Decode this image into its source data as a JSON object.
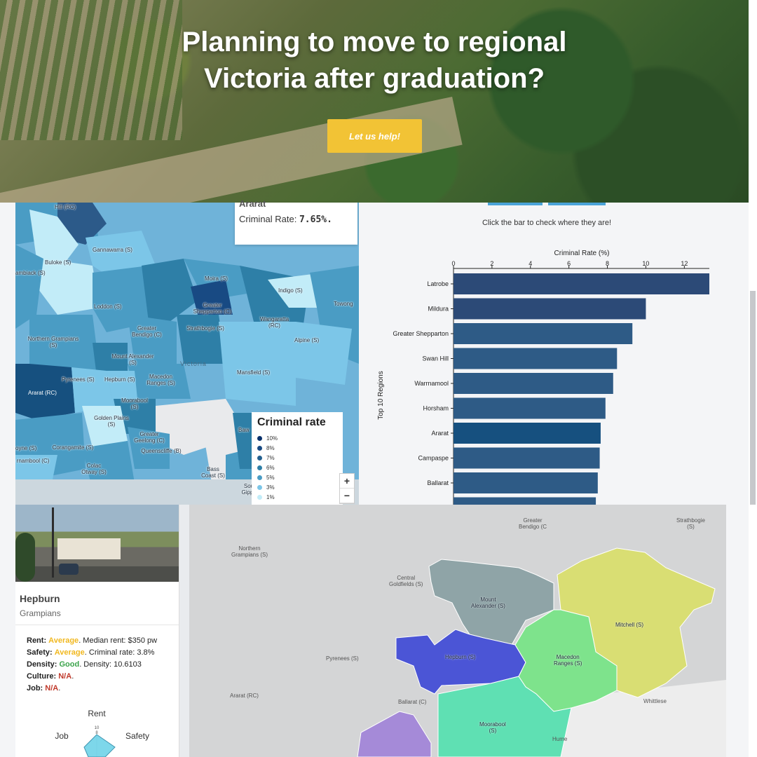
{
  "hero": {
    "title_line1": "Planning to move to regional",
    "title_line2": "Victoria after graduation?",
    "cta_label": "Let us help!"
  },
  "crime_map": {
    "tooltip": {
      "region": "Ararat",
      "rate_label": "Criminal Rate:",
      "rate_value": "7.65%."
    },
    "legend": {
      "title": "Criminal rate",
      "items": [
        {
          "label": "10%",
          "color": "#08306b"
        },
        {
          "label": "8%",
          "color": "#184a83"
        },
        {
          "label": "7%",
          "color": "#23608f"
        },
        {
          "label": "6%",
          "color": "#2e7fa7"
        },
        {
          "label": "5%",
          "color": "#4a9cc4"
        },
        {
          "label": "3%",
          "color": "#7cc6e8"
        },
        {
          "label": "1%",
          "color": "#c2ecf8"
        }
      ]
    },
    "zoom": {
      "in": "+",
      "out": "−"
    },
    "region_labels": [
      "Hill (RC)",
      "Gannawarra (S)",
      "Buloke (S)",
      "ambiack (S)",
      "Moira (S)",
      "Indigo (S)",
      "Greater Shepparton (C)",
      "Towong",
      "Loddon (S)",
      "Wangaratta (RC)",
      "Greater Bendigo (C)",
      "Strathbogie (S)",
      "Northern Grampians (S)",
      "Alpine (S)",
      "Mount Alexander (S)",
      "Pyrenees (S)",
      "Hepburn (S)",
      "Macedon Ranges (S)",
      "Ararat (RC)",
      "Mansfield (S)",
      "Moorabool (S)",
      "Golden Plains (S)",
      "Greater Geelong (C)",
      "Queenscliffe (B)",
      "oyne (S)",
      "Corangamite (S)",
      "rnambool (C)",
      "Colac Otway (S)",
      "Bass Coast (S)",
      "Baw",
      "Sou Gipps",
      "Victoria"
    ]
  },
  "bar_chart": {
    "hint": "Click the bar to check where they are!",
    "chart_data": {
      "type": "bar",
      "orientation": "horizontal",
      "title": "Criminal Rate (%)",
      "ylabel": "Top 10 Regions",
      "categories": [
        "Latrobe",
        "Mildura",
        "Greater Shepparton",
        "Swan Hill",
        "Warrnamool",
        "Horsham",
        "Ararat",
        "Campaspe",
        "Ballarat"
      ],
      "values": [
        13.3,
        10.0,
        9.3,
        8.5,
        8.3,
        7.9,
        7.65,
        7.6,
        7.5
      ],
      "highlight": "Ararat",
      "xlim": [
        0,
        13.3
      ],
      "xticks": [
        0,
        2,
        4,
        6,
        8,
        10,
        12
      ],
      "colors": {
        "bar": "#2e5b86",
        "highlight": "#16507f",
        "top": "#2c4a77"
      }
    }
  },
  "region_card": {
    "name": "Hepburn",
    "region": "Grampians",
    "rows": [
      {
        "key": "Rent:",
        "rating": "Average",
        "rating_class": "yellow",
        "detail": ". Median rent: $350 pw"
      },
      {
        "key": "Safety:",
        "rating": "Average",
        "rating_class": "yellow",
        "detail": ". Criminal rate: 3.8%"
      },
      {
        "key": "Density:",
        "rating": "Good",
        "rating_class": "green",
        "detail": ". Density: 10.6103"
      },
      {
        "key": "Culture:",
        "rating": "N/A",
        "rating_class": "red",
        "detail": "."
      },
      {
        "key": "Job:",
        "rating": "N/A",
        "rating_class": "red",
        "detail": "."
      }
    ],
    "radar": {
      "top": "Rent",
      "left": "Job",
      "right": "Safety",
      "tick_max": "10",
      "tick_mid": "8"
    }
  },
  "cluster_map": {
    "labels": {
      "greater_bendigo": "Greater\nBendigo (C",
      "strathbogie": "Strathbogie\n(S)",
      "northern_grampians": "Northern\nGrampians (S)",
      "central_goldfields": "Central\nGoldfields (S)",
      "mount_alexander": "Mount\nAlexander (S)",
      "mitchell": "Mitchell (S)",
      "pyrenees": "Pyrenees (S)",
      "hepburn": "Hepburn (S)",
      "macedon": "Macedon\nRanges (S)",
      "ararat": "Ararat (RC)",
      "ballarat": "Ballarat (C)",
      "whittlesea": "Whittlese",
      "moorabool": "Moorabool\n(S)",
      "hume": "Hume"
    },
    "colors": {
      "mount_alexander": "#8fa4a7",
      "mitchell": "#d9de73",
      "hepburn": "#4b55d6",
      "macedon": "#7ee38c",
      "moorabool": "#5fe0b3",
      "golden_plains": "#a58ad8"
    }
  }
}
